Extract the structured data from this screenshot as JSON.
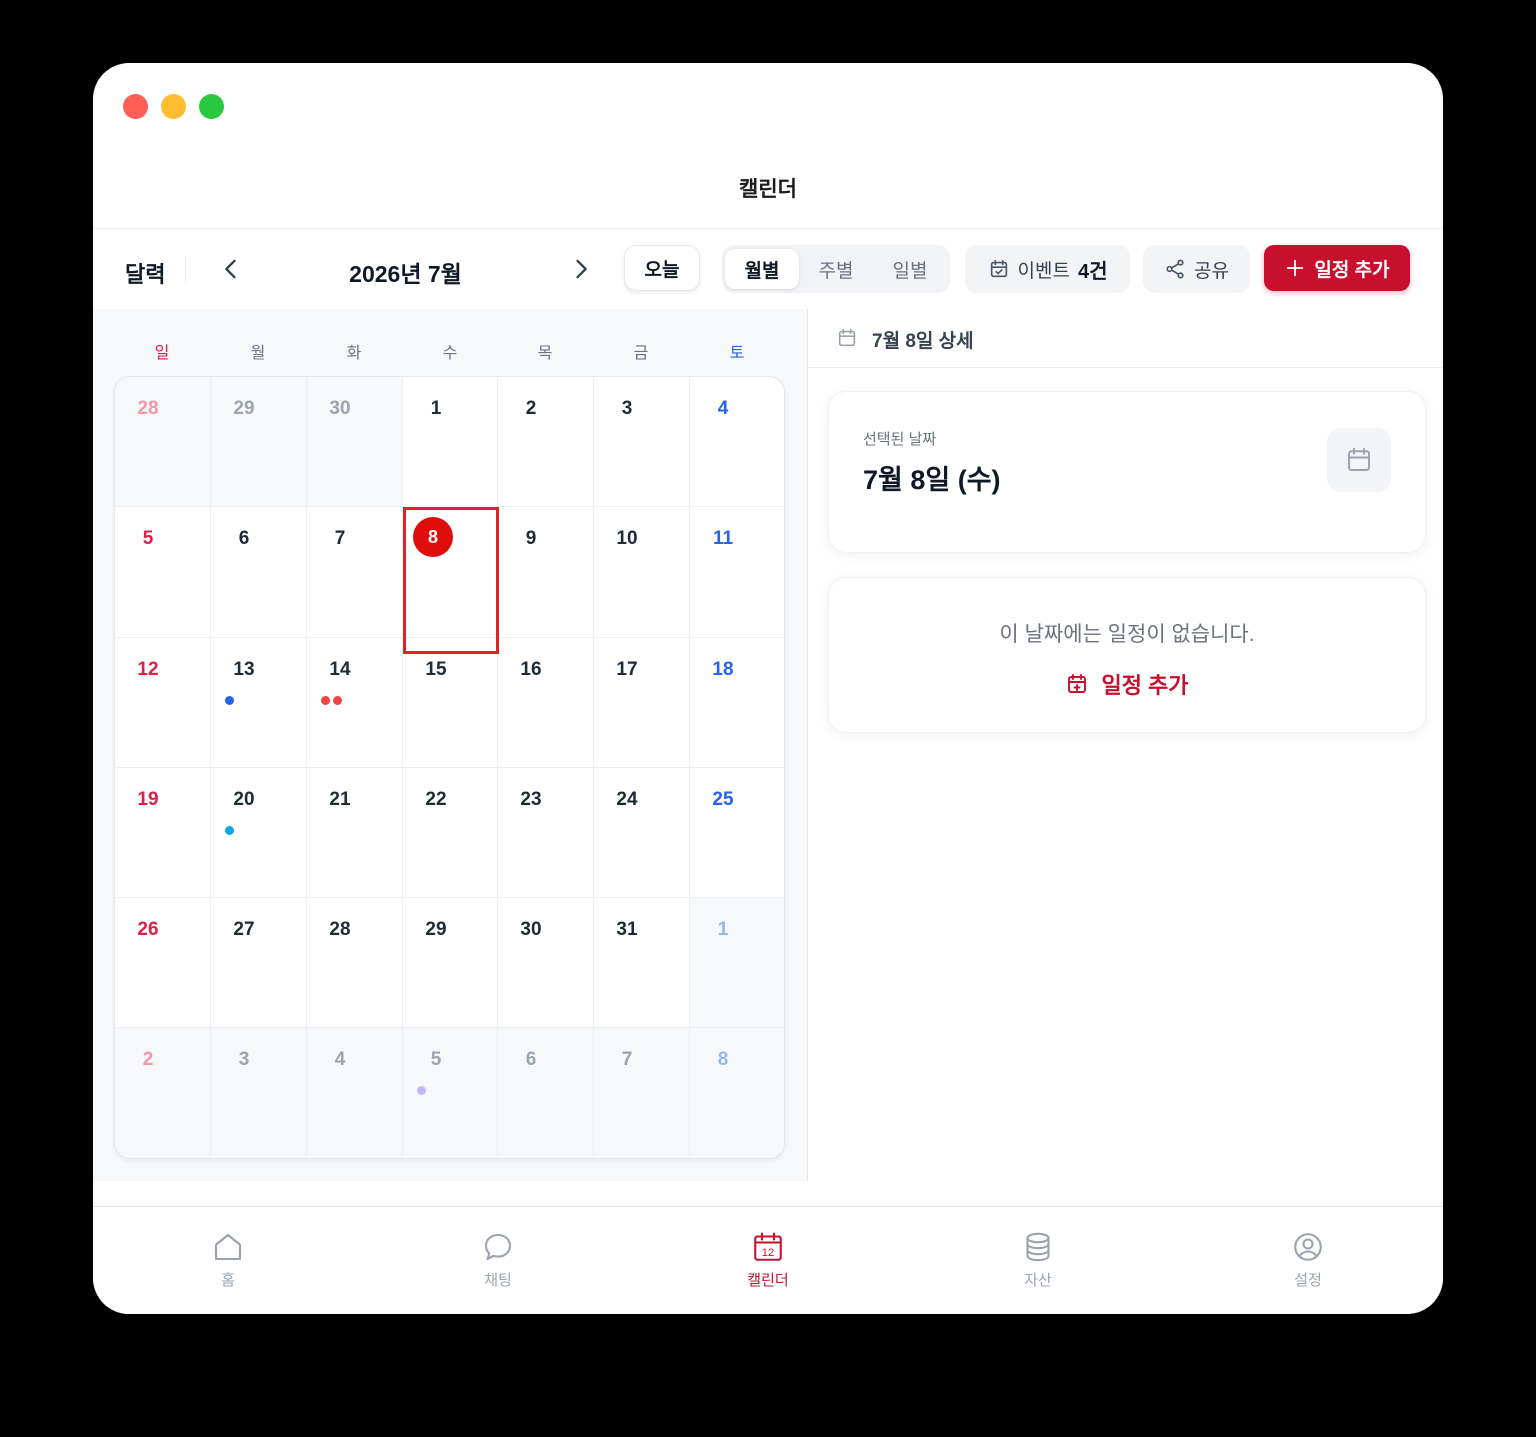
{
  "window": {
    "title": "캘린더"
  },
  "toolbar": {
    "label": "달력",
    "month": "2026년 7월",
    "today": "오늘",
    "views": [
      "월별",
      "주별",
      "일별"
    ],
    "events_label": "이벤트",
    "events_count": "4건",
    "share": "공유",
    "add": "일정 추가"
  },
  "weekdays": [
    "일",
    "월",
    "화",
    "수",
    "목",
    "금",
    "토"
  ],
  "calendar": {
    "selected_index": 10,
    "days": [
      {
        "n": "28",
        "muted": true
      },
      {
        "n": "29",
        "muted": true
      },
      {
        "n": "30",
        "muted": true
      },
      {
        "n": "1"
      },
      {
        "n": "2"
      },
      {
        "n": "3"
      },
      {
        "n": "4"
      },
      {
        "n": "5"
      },
      {
        "n": "6"
      },
      {
        "n": "7"
      },
      {
        "n": "8",
        "today": true
      },
      {
        "n": "9"
      },
      {
        "n": "10"
      },
      {
        "n": "11"
      },
      {
        "n": "12"
      },
      {
        "n": "13",
        "dots": [
          "#2563eb"
        ]
      },
      {
        "n": "14",
        "dots": [
          "#ef4444",
          "#ef4444"
        ]
      },
      {
        "n": "15"
      },
      {
        "n": "16"
      },
      {
        "n": "17"
      },
      {
        "n": "18"
      },
      {
        "n": "19"
      },
      {
        "n": "20",
        "dots": [
          "#0ea5e9"
        ]
      },
      {
        "n": "21"
      },
      {
        "n": "22"
      },
      {
        "n": "23"
      },
      {
        "n": "24"
      },
      {
        "n": "25"
      },
      {
        "n": "26"
      },
      {
        "n": "27"
      },
      {
        "n": "28"
      },
      {
        "n": "29"
      },
      {
        "n": "30"
      },
      {
        "n": "31"
      },
      {
        "n": "1",
        "muted": true
      },
      {
        "n": "2",
        "muted": true
      },
      {
        "n": "3",
        "muted": true
      },
      {
        "n": "4",
        "muted": true
      },
      {
        "n": "5",
        "muted": true,
        "dots": [
          "#c4b5fd"
        ]
      },
      {
        "n": "6",
        "muted": true
      },
      {
        "n": "7",
        "muted": true
      },
      {
        "n": "8",
        "muted": true
      }
    ]
  },
  "detail": {
    "header": "7월 8일 상세",
    "selected_label": "선택된 날짜",
    "selected_date": "7월 8일 (수)",
    "empty_text": "이 날짜에는 일정이 없습니다.",
    "add_label": "일정 추가"
  },
  "tabs": [
    {
      "label": "홈",
      "icon": "home-icon"
    },
    {
      "label": "채팅",
      "icon": "chat-icon"
    },
    {
      "label": "캘린더",
      "icon": "calendar-icon",
      "active": true
    },
    {
      "label": "자산",
      "icon": "database-icon"
    },
    {
      "label": "설정",
      "icon": "user-circle-icon"
    }
  ],
  "colors": {
    "accent": "#c8102e",
    "sunday": "#e11d48",
    "saturday": "#2563eb",
    "today": "#e00d0d"
  }
}
